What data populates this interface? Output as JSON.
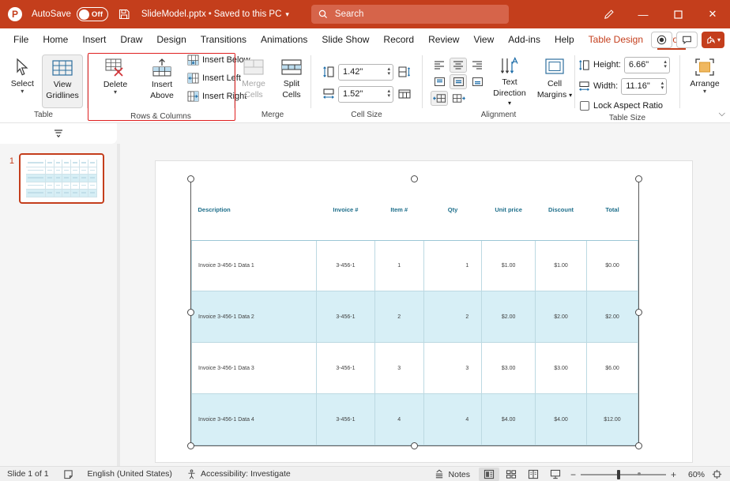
{
  "titlebar": {
    "logo": "P",
    "autosave_label": "AutoSave",
    "autosave_state": "Off",
    "save_icon": "save-icon",
    "filename": "SlideModel.pptx",
    "separator": "•",
    "save_location": "Saved to this PC",
    "dropdown_caret": "⌵",
    "search_placeholder": "Search",
    "search_icon": "search-icon",
    "draw_icon": "pen-icon",
    "minimize": "—",
    "maximize": "☐",
    "close": "✕",
    "bg_color": "#c43e1c"
  },
  "tabs": [
    {
      "label": "File",
      "state": "normal"
    },
    {
      "label": "Home",
      "state": "normal"
    },
    {
      "label": "Insert",
      "state": "normal"
    },
    {
      "label": "Draw",
      "state": "normal"
    },
    {
      "label": "Design",
      "state": "normal"
    },
    {
      "label": "Transitions",
      "state": "normal"
    },
    {
      "label": "Animations",
      "state": "normal"
    },
    {
      "label": "Slide Show",
      "state": "normal"
    },
    {
      "label": "Record",
      "state": "normal"
    },
    {
      "label": "Review",
      "state": "normal"
    },
    {
      "label": "View",
      "state": "normal"
    },
    {
      "label": "Add-ins",
      "state": "normal"
    },
    {
      "label": "Help",
      "state": "normal"
    },
    {
      "label": "Table Design",
      "state": "contextual"
    },
    {
      "label": "Layout",
      "state": "active"
    }
  ],
  "tabs_right": {
    "record_button": "record-icon",
    "comments_button": "comment-icon",
    "share_label": "",
    "share_caret": "⌵"
  },
  "ribbon": {
    "collapse_caret": "⌵",
    "groups": [
      {
        "title": "Table",
        "buttons": [
          {
            "label": "Select",
            "icon": "cursor-arrow-icon",
            "caret": "⌵",
            "state": "normal"
          },
          {
            "label_line1": "View",
            "label_line2": "Gridlines",
            "icon": "gridlines-icon",
            "state": "selected"
          }
        ]
      },
      {
        "title": "Rows & Columns",
        "highlighted": true,
        "buttons": [
          {
            "label": "Delete",
            "icon": "delete-table-icon",
            "caret": "⌵"
          },
          {
            "label_line1": "Insert",
            "label_line2": "Above",
            "icon": "insert-above-icon"
          }
        ],
        "small_buttons": [
          {
            "label": "Insert Below",
            "icon": "insert-below-icon"
          },
          {
            "label": "Insert Left",
            "icon": "insert-left-icon"
          },
          {
            "label": "Insert Right",
            "icon": "insert-right-icon"
          }
        ]
      },
      {
        "title": "Merge",
        "buttons": [
          {
            "label_line1": "Merge",
            "label_line2": "Cells",
            "icon": "merge-cells-icon",
            "state": "disabled"
          },
          {
            "label_line1": "Split",
            "label_line2": "Cells",
            "icon": "split-cells-icon",
            "state": "normal"
          }
        ]
      },
      {
        "title": "Cell Size",
        "fields": [
          {
            "icon": "cell-height-icon",
            "value": "1.42\"",
            "extra_icon": "distribute-rows-icon"
          },
          {
            "icon": "cell-width-icon",
            "value": "1.52\"",
            "extra_icon": "distribute-columns-icon"
          }
        ]
      },
      {
        "title": "Alignment",
        "align_buttons": [
          {
            "icon": "align-left-icon",
            "state": "normal"
          },
          {
            "icon": "align-center-icon",
            "state": "selected"
          },
          {
            "icon": "align-right-icon",
            "state": "normal"
          },
          {
            "icon": "align-top-icon",
            "state": "normal"
          },
          {
            "icon": "align-middle-icon",
            "state": "selected"
          },
          {
            "icon": "align-bottom-icon",
            "state": "normal"
          },
          {
            "icon": "text-direction-ltr-icon",
            "state": "selected"
          },
          {
            "icon": "text-direction-rtl-icon",
            "state": "normal"
          }
        ],
        "buttons": [
          {
            "label_line1": "Text",
            "label_line2": "Direction",
            "icon": "text-direction-icon",
            "caret": "⌵"
          },
          {
            "label_line1": "Cell",
            "label_line2": "Margins",
            "icon": "cell-margins-icon",
            "caret": "⌵"
          }
        ]
      },
      {
        "title": "Table Size",
        "fields": [
          {
            "icon": "table-height-icon",
            "label": "Height:",
            "value": "6.66\""
          },
          {
            "icon": "table-width-icon",
            "label": "Width:",
            "value": "11.16\""
          }
        ],
        "checkbox": {
          "label": "Lock Aspect Ratio",
          "checked": false
        }
      },
      {
        "title": "",
        "buttons": [
          {
            "label": "Arrange",
            "icon": "arrange-icon",
            "caret": "⌵"
          }
        ]
      }
    ]
  },
  "toolstrip": {
    "caret": "⌵"
  },
  "thumbnail_pane": {
    "slides": [
      {
        "number": "1",
        "selected": true
      }
    ]
  },
  "slide_table": {
    "headers": [
      "Description",
      "Invoice #",
      "Item #",
      "Qty",
      "Unit price",
      "Discount",
      "Total"
    ],
    "rows": [
      {
        "cells": [
          "Invoice 3-456-1 Data 1",
          "3-456-1",
          "1",
          "1",
          "$1.00",
          "$1.00",
          "$0.00"
        ],
        "highlight": false
      },
      {
        "cells": [
          "Invoice 3-456-1 Data 2",
          "3-456-1",
          "2",
          "2",
          "$2.00",
          "$2.00",
          "$2.00"
        ],
        "highlight": true
      },
      {
        "cells": [
          "Invoice 3-456-1 Data 3",
          "3-456-1",
          "3",
          "3",
          "$3.00",
          "$3.00",
          "$6.00"
        ],
        "highlight": false
      },
      {
        "cells": [
          "Invoice 3-456-1 Data 4",
          "3-456-1",
          "4",
          "4",
          "$4.00",
          "$4.00",
          "$12.00"
        ],
        "highlight": true
      }
    ],
    "header_color": "#1f6f8b",
    "alt_row_color": "#d7eff6",
    "border_color": "#bcd9e2"
  },
  "status_bar": {
    "slide_counter": "Slide 1 of 1",
    "notes_page_icon": "notes-page-icon",
    "language": "English (United States)",
    "accessibility_icon": "accessibility-icon",
    "accessibility": "Accessibility: Investigate",
    "notes_label": "Notes",
    "notes_icon": "notes-caret-icon",
    "views": [
      {
        "icon": "normal-view-icon",
        "active": true
      },
      {
        "icon": "slide-sorter-icon",
        "active": false
      },
      {
        "icon": "reading-view-icon",
        "active": false
      },
      {
        "icon": "slide-show-icon",
        "active": false
      }
    ],
    "zoom_out": "−",
    "zoom_in": "+",
    "zoom_level": "60%",
    "fit_icon": "fit-slide-icon"
  }
}
